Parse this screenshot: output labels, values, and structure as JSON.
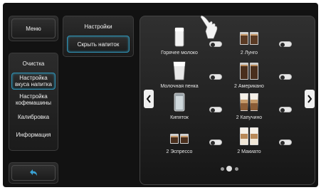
{
  "left_menu": {
    "menu_label": "Меню",
    "items": [
      {
        "label": "Очистка",
        "active": false
      },
      {
        "label": "Настройка вкуса напитка",
        "active": true
      },
      {
        "label": "Настройка кофемашины",
        "active": false
      },
      {
        "label": "Калибровка",
        "active": false
      },
      {
        "label": "Информация",
        "active": false
      }
    ],
    "back_icon": "back-arrow-icon"
  },
  "middle": {
    "settings_label": "Настройки",
    "hide_drink_label": "Скрыть напиток"
  },
  "drinks": [
    {
      "name": "Горячее молоко",
      "icon": "milk-glass-icon",
      "enabled": true
    },
    {
      "name": "2 Лунго",
      "icon": "two-lungo-icon",
      "enabled": true
    },
    {
      "name": "Молочная пенка",
      "icon": "milk-foam-icon",
      "enabled": true
    },
    {
      "name": "2 Американо",
      "icon": "two-americano-icon",
      "enabled": true
    },
    {
      "name": "Кипяток",
      "icon": "hot-water-icon",
      "enabled": true
    },
    {
      "name": "2 Капучино",
      "icon": "two-cappuccino-icon",
      "enabled": true
    },
    {
      "name": "2 Эспрессо",
      "icon": "two-espresso-icon",
      "enabled": true
    },
    {
      "name": "2 Макиато",
      "icon": "two-macchiato-icon",
      "enabled": true
    }
  ],
  "pagination": {
    "pages": 3,
    "current": 2
  },
  "colors": {
    "accent": "#2f8fb0",
    "background": "#121212"
  }
}
